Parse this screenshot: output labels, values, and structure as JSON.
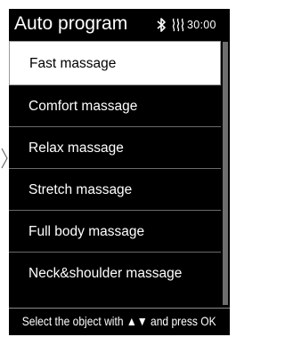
{
  "header": {
    "title": "Auto program",
    "timer": "30:00",
    "icons": [
      "bluetooth-icon",
      "heat-icon"
    ]
  },
  "menu": {
    "selected_index": 0,
    "items": [
      {
        "label": "Fast massage"
      },
      {
        "label": "Comfort massage"
      },
      {
        "label": "Relax massage"
      },
      {
        "label": "Stretch massage"
      },
      {
        "label": "Full body massage"
      },
      {
        "label": "Neck&shoulder massage"
      }
    ]
  },
  "scrollbar": {
    "visible_fraction": 1.0
  },
  "footer": {
    "hint": "Select the object with ▲▼ and press OK"
  },
  "colors": {
    "screen_background": "#000000",
    "text": "#ffffff",
    "selected_background": "#ffffff",
    "selected_text": "#000000",
    "divider": "#6a6a6a",
    "scroll_track": "#2a2a2a",
    "scroll_thumb": "#6e6e6e"
  }
}
